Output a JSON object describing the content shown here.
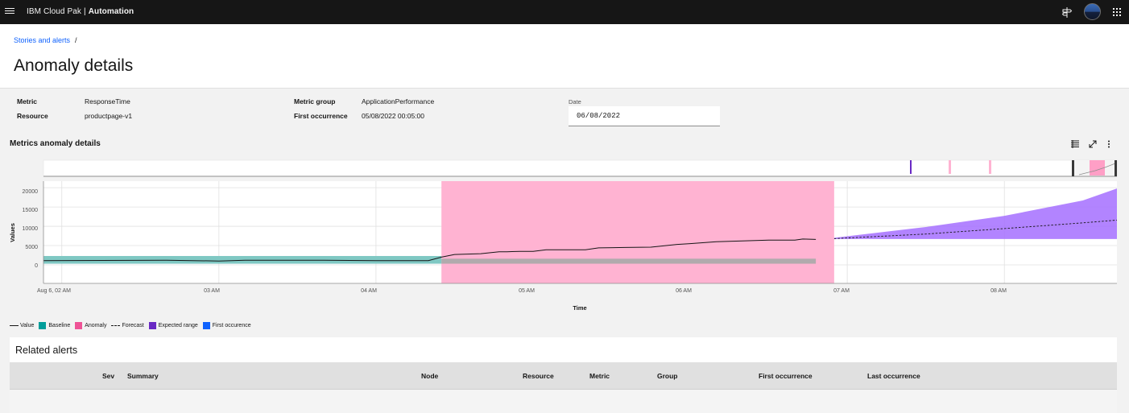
{
  "topbar": {
    "brand_prefix": "IBM Cloud Pak",
    "brand_separator": "|",
    "brand_product": "Automation",
    "icons": [
      "menu-icon",
      "notification-icon",
      "avatar",
      "app-switcher-icon"
    ],
    "bg_color": "#161616"
  },
  "breadcrumb": {
    "item": "Stories and alerts",
    "separator": "/"
  },
  "page": {
    "title": "Anomaly details"
  },
  "details": {
    "metric_label": "Metric",
    "metric_value": "ResponseTime",
    "resource_label": "Resource",
    "resource_value": "productpage-v1",
    "metric_group_label": "Metric group",
    "metric_group_value": "ApplicationPerformance",
    "first_occurrence_label": "First occurrence",
    "first_occurrence_value": "05/08/2022 00:05:00",
    "date_label": "Date",
    "date_value": "06/08/2022"
  },
  "metrics_section": {
    "title": "Metrics anomaly details",
    "toolbar_icons": [
      "table-view-icon",
      "maximize-icon",
      "overflow-menu-icon"
    ]
  },
  "chart_data": {
    "type": "line",
    "xlabel": "Time",
    "ylabel": "Values",
    "yticks": [
      "20000",
      "15000",
      "10000",
      "5000",
      "0"
    ],
    "ylim": [
      -4800,
      21700
    ],
    "xticks": [
      "Aug 6, 02 AM",
      "03 AM",
      "04 AM",
      "05 AM",
      "06 AM",
      "07 AM",
      "08 AM"
    ],
    "xlim": [
      "2022-08-06T01:53",
      "2022-08-06T08:43"
    ],
    "grid": true,
    "series": [
      {
        "name": "Value",
        "color": "#161616",
        "x": [
          "01:53",
          "02:40",
          "03:00",
          "03:10",
          "03:40",
          "04:00",
          "04:20",
          "04:25",
          "04:30",
          "04:40",
          "04:47",
          "04:50",
          "04:55",
          "05:00",
          "05:05",
          "05:20",
          "05:25",
          "05:35",
          "05:45",
          "05:55",
          "06:00",
          "06:10",
          "06:20",
          "06:30",
          "06:40",
          "06:43",
          "06:48"
        ],
        "y": [
          1100,
          1200,
          1000,
          1200,
          1200,
          1100,
          1100,
          2000,
          2700,
          2900,
          3400,
          3400,
          3500,
          3500,
          3900,
          3900,
          4400,
          4500,
          4600,
          5300,
          5500,
          6000,
          6200,
          6400,
          6400,
          6700,
          6600
        ]
      },
      {
        "name": "Baseline",
        "color": "#009d9a",
        "x_range": [
          "01:53",
          "04:25"
        ],
        "y_range": [
          300,
          2300
        ]
      },
      {
        "name": "Forecast",
        "color": "#161616",
        "dashed": true,
        "x": [
          "06:55",
          "07:30",
          "08:00",
          "08:30",
          "08:43"
        ],
        "y": [
          6800,
          8000,
          9400,
          10900,
          11600
        ]
      },
      {
        "name": "Expected range",
        "color": "#8a3ffc",
        "x": [
          "06:55",
          "07:30",
          "08:00",
          "08:30",
          "08:43"
        ],
        "y_low": [
          6700,
          6700,
          6700,
          6700,
          6700
        ],
        "y_high": [
          7000,
          9800,
          12700,
          16700,
          19800
        ]
      }
    ],
    "anomaly": {
      "name": "Anomaly",
      "color": "#ff7eb6",
      "x_start": "04:25",
      "x_end": "06:55"
    },
    "gray_band": {
      "x_start": "04:25",
      "x_end": "06:48",
      "y_range": [
        300,
        1600
      ],
      "color": "#a8a8a8"
    },
    "legend": [
      "Value",
      "Baseline",
      "Anomaly",
      "Forecast",
      "Expected range",
      "First occurence"
    ],
    "legend_placement": "bottom-left"
  },
  "legend": {
    "value": "Value",
    "baseline": "Baseline",
    "anomaly": "Anomaly",
    "forecast": "Forecast",
    "expected_range": "Expected range",
    "first_occurrence": "First occurence",
    "colors": {
      "baseline": "#009d9a",
      "anomaly": "#ee5396",
      "expected_range": "#6929c4",
      "first_occurrence": "#0f62fe"
    }
  },
  "related_alerts": {
    "title": "Related alerts",
    "columns": [
      "Sev",
      "Summary",
      "Node",
      "Resource",
      "Metric",
      "Group",
      "First occurrence",
      "Last occurrence"
    ]
  }
}
